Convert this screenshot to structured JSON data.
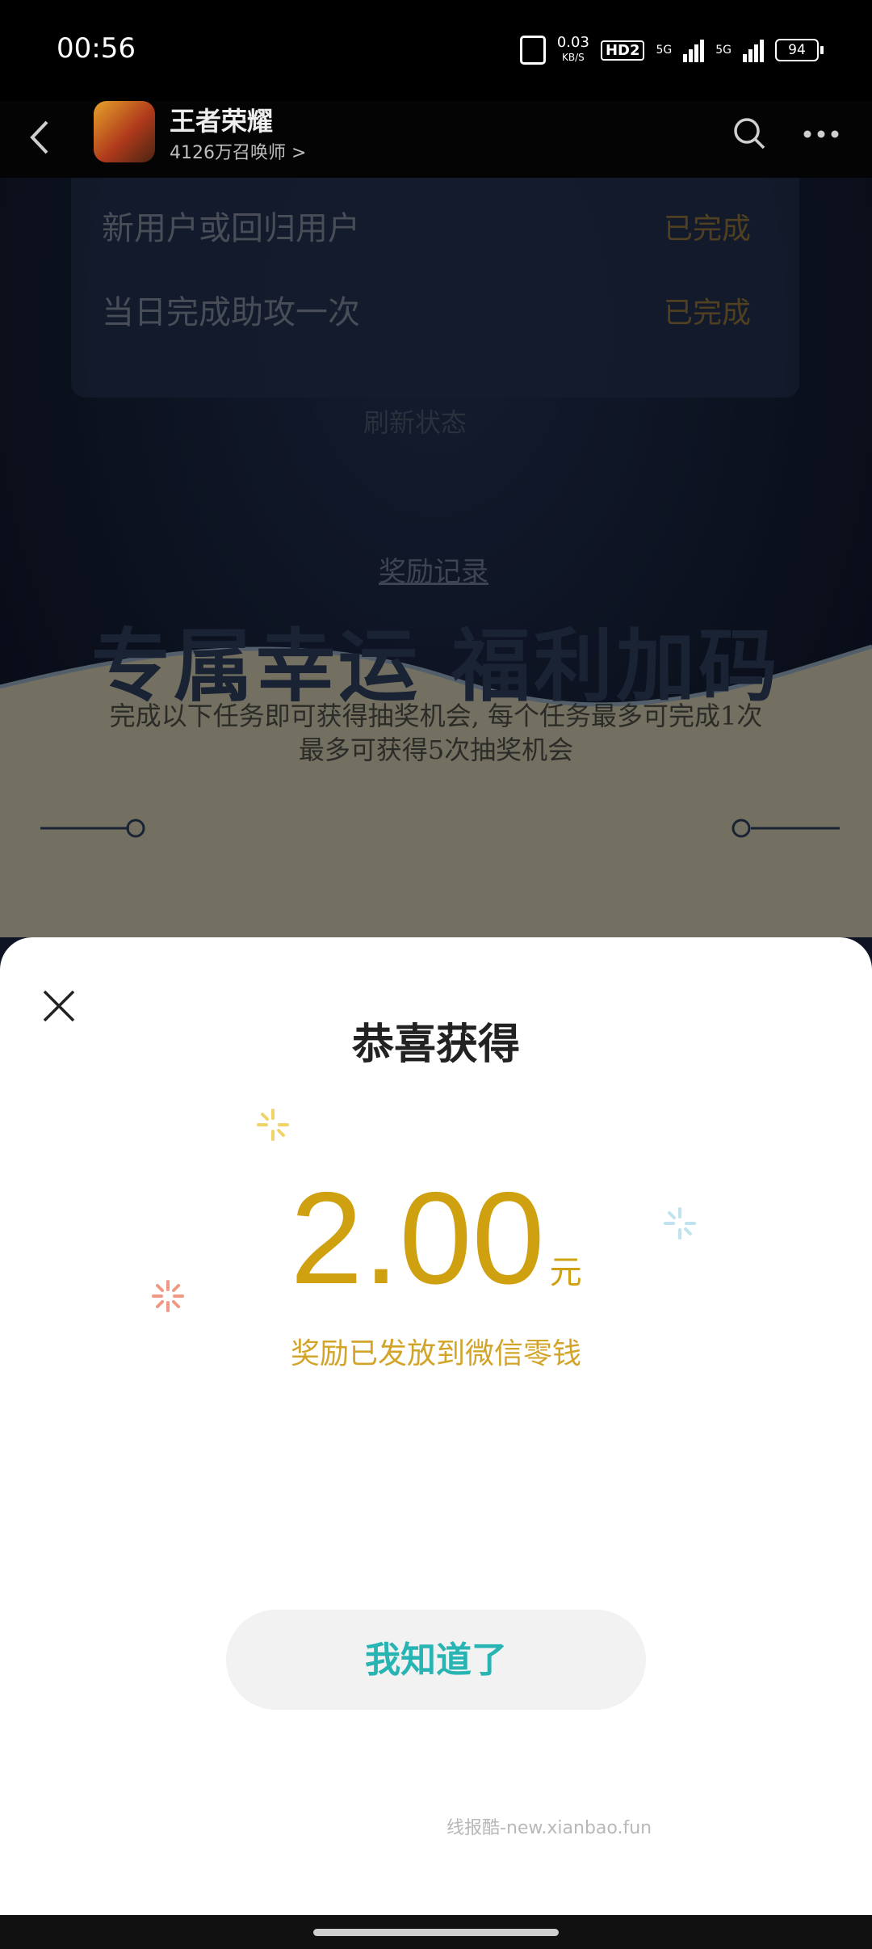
{
  "status_bar": {
    "time": "00:56",
    "speed_value": "0.03",
    "speed_unit": "KB/S",
    "hd": "HD2",
    "sim1": "5G",
    "sim2": "5G",
    "battery": "94"
  },
  "header": {
    "title": "王者荣耀",
    "subtitle": "4126万召唤师 >"
  },
  "background": {
    "tasks": [
      {
        "label": "新用户或回归用户",
        "status": "已完成"
      },
      {
        "label": "当日完成助攻一次",
        "status": "已完成"
      }
    ],
    "refresh": "刷新状态",
    "reward_link": "奖励记录",
    "promo_title": "专属幸运 福利加码",
    "promo_desc": "完成以下任务即可获得抽奖机会, 每个任务最多可完成1次",
    "promo_desc2": "最多可获得5次抽奖机会"
  },
  "dialog": {
    "title": "恭喜获得",
    "amount": "2.00",
    "unit": "元",
    "note": "奖励已发放到微信零钱",
    "button": "我知道了",
    "watermark": "线报酷-new.xianbao.fun"
  }
}
